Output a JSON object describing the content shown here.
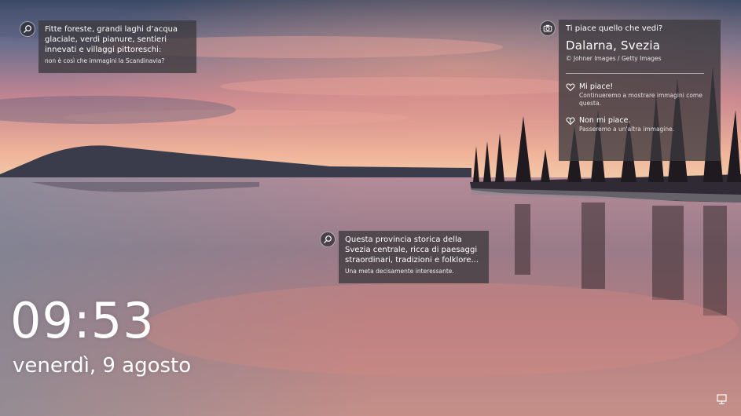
{
  "hotspot_left": {
    "icon": "search-icon",
    "headline": "Fitte foreste, grandi laghi d’acqua glaciale, verdi pianure, sentieri innevati e villaggi pittoreschi:",
    "subtext": "non è così che immagini la Scandinavia?"
  },
  "hotspot_center": {
    "icon": "search-icon",
    "headline": "Questa provincia storica della Svezia centrale, ricca di paesaggi straordinari, tradizioni e folklore...",
    "subtext": "Una meta decisamente interessante."
  },
  "feedback": {
    "icon": "camera-icon",
    "title": "Ti piace quello che vedi?",
    "place": "Dalarna, Svezia",
    "credit": "© Johner Images / Getty Images",
    "like_label": "Mi piace!",
    "like_desc": "Continueremo a mostrare immagini come questa.",
    "dislike_label": "Non mi piace.",
    "dislike_desc": "Passeremo a un'altra immagine."
  },
  "lock": {
    "time": "09:53",
    "date": "venerdì, 9 agosto"
  },
  "status": {
    "network_icon": "network-icon"
  },
  "colors": {
    "sky_top": "#3f4d68",
    "sunset": "#e8907c",
    "water": "#b97f86"
  }
}
